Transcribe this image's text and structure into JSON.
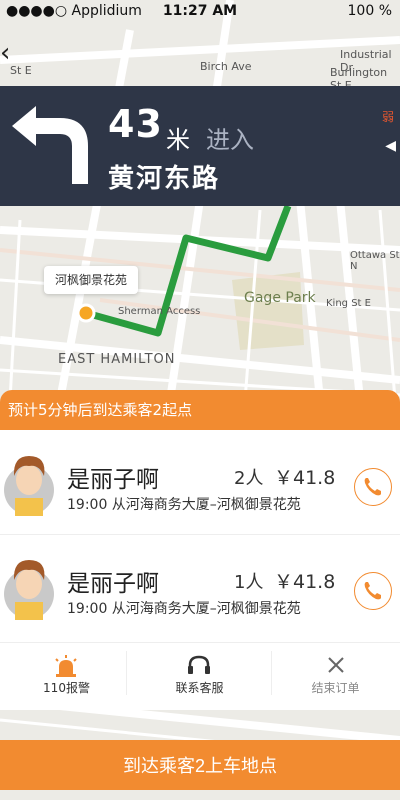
{
  "status_bar": {
    "carrier": "●●●●○ Applidium",
    "time": "11:27 AM",
    "battery": "100 %"
  },
  "map": {
    "labels": {
      "gage_park": "Gage Park",
      "east_hamilton": "EAST HAMILTON",
      "industrial_dr": "Industrial Dr",
      "burlington_st": "Burlington St E",
      "ottawa_st": "Ottawa St N",
      "kingsl_st": "King St E",
      "sherman_access": "Sherman Access",
      "birch_ave": "Birch Ave",
      "top_st": "St E"
    },
    "popup": "河枫御景花苑",
    "right_edge_cn1": "西",
    "right_edge_cn2": "南",
    "right_edge_cn3": "弱"
  },
  "nav": {
    "distance": "43",
    "unit": "米",
    "action": "进入",
    "road": "黄河东路"
  },
  "eta_banner": "预计5分钟后到达乘客2起点",
  "passengers": [
    {
      "name": "是丽子啊",
      "count": "2人",
      "price": "￥41.8",
      "route": "19:00 从河海商务大厦–河枫御景花苑"
    },
    {
      "name": "是丽子啊",
      "count": "1人",
      "price": "￥41.8",
      "route": "19:00 从河海商务大厦–河枫御景花苑"
    }
  ],
  "actions": {
    "alarm": "110报警",
    "service": "联系客服",
    "end": "结束订单"
  },
  "bottom_button": "到达乘客2上车地点",
  "colors": {
    "orange": "#f28b30",
    "nav_bg": "#2e3647",
    "route": "#2a9c3e"
  }
}
